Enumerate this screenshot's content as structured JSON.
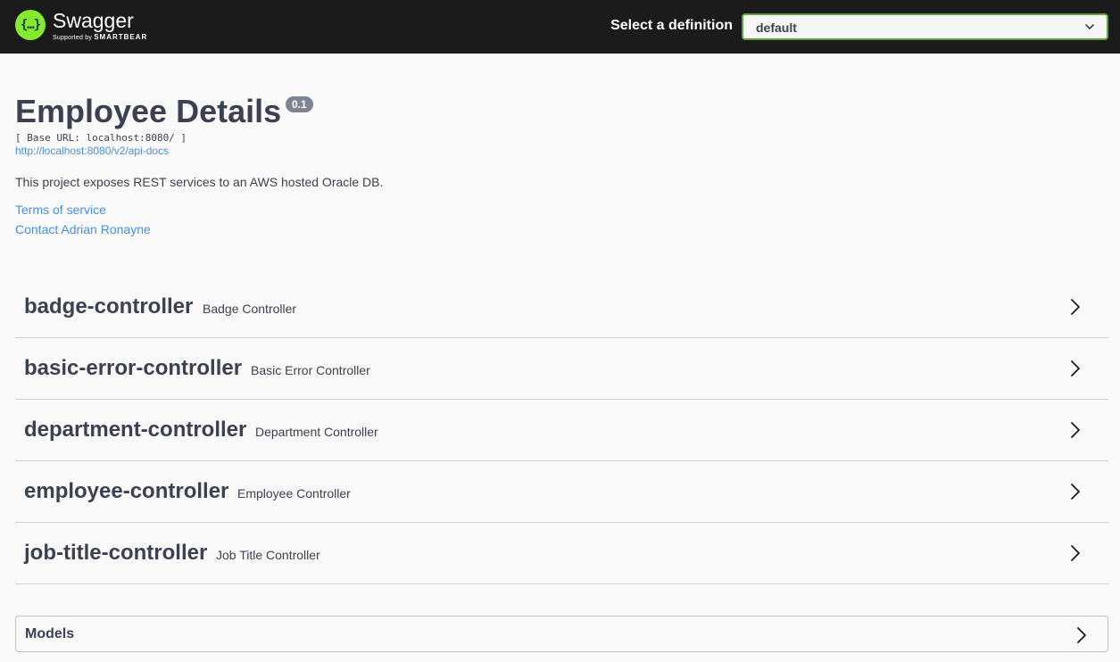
{
  "topbar": {
    "logo_icon": "{…}",
    "logo_name": "Swagger",
    "logo_sub_prefix": "Supported by",
    "logo_sub_brand": "SMARTBEAR",
    "select_label": "Select a definition",
    "select_value": "default"
  },
  "info": {
    "title": "Employee Details",
    "version": "0.1",
    "base_url": "[ Base URL: localhost:8080/ ]",
    "docs_link": "http://localhost:8080/v2/api-docs",
    "description": "This project exposes REST services to an AWS hosted Oracle DB.",
    "terms_link": "Terms of service",
    "contact_link": "Contact Adrian Ronayne"
  },
  "tags": [
    {
      "name": "badge-controller",
      "description": "Badge Controller"
    },
    {
      "name": "basic-error-controller",
      "description": "Basic Error Controller"
    },
    {
      "name": "department-controller",
      "description": "Department Controller"
    },
    {
      "name": "employee-controller",
      "description": "Employee Controller"
    },
    {
      "name": "job-title-controller",
      "description": "Job Title Controller"
    }
  ],
  "models": {
    "title": "Models"
  },
  "colors": {
    "topbar_bg": "#1b1b1b",
    "logo_green": "#85ea2d",
    "select_border": "#62a03f",
    "link_blue": "#4990e2",
    "text_dark": "#3b4151",
    "badge_grey": "#7d8492"
  },
  "icons": {
    "logo": "swagger-logo-icon",
    "select_chevron": "chevron-down-icon",
    "tag_chevron": "chevron-right-icon"
  }
}
